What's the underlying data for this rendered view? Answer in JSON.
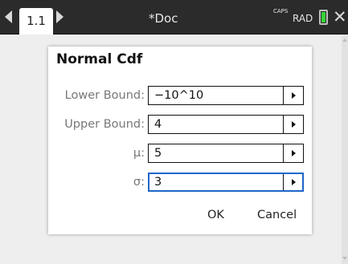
{
  "topbar": {
    "tab_label": "1.1",
    "doc_title": "*Doc",
    "caps_indicator": "CAPS",
    "angle_mode": "RAD",
    "battery_color": "#35d335",
    "icons": [
      "left-arrow",
      "right-arrow",
      "battery",
      "close"
    ]
  },
  "dialog": {
    "title": "Normal Cdf",
    "fields": [
      {
        "label": "Lower Bound:",
        "value": "−10^10"
      },
      {
        "label": "Upper Bound:",
        "value": "4"
      },
      {
        "label": "μ:",
        "value": "5"
      },
      {
        "label": "σ:",
        "value": "3"
      }
    ],
    "ok_label": "OK",
    "cancel_label": "Cancel",
    "focus_color": "#1f66c9"
  }
}
